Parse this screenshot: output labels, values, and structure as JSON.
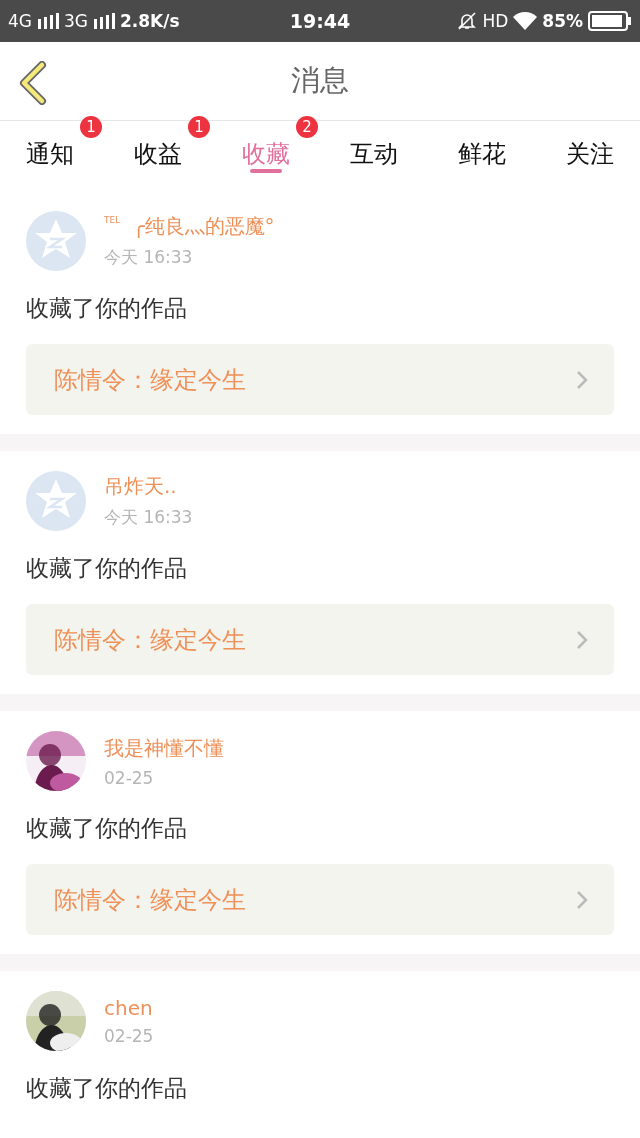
{
  "status_bar": {
    "network_1": "4G",
    "network_2": "3G",
    "speed": "2.8K/s",
    "time": "19:44",
    "hd": "HD",
    "battery": "85%"
  },
  "header": {
    "title": "消息"
  },
  "tabs": [
    {
      "label": "通知",
      "selected": false,
      "badge": "1"
    },
    {
      "label": "收益",
      "selected": false,
      "badge": "1"
    },
    {
      "label": "收藏",
      "selected": true,
      "badge": "2"
    },
    {
      "label": "互动",
      "selected": false
    },
    {
      "label": "鲜花",
      "selected": false
    },
    {
      "label": "关注",
      "selected": false
    }
  ],
  "messages": [
    {
      "avatar": {
        "kind": "default"
      },
      "user": "$^{TEL}$ ╭纯良灬的恶魔°",
      "time": "今天 16:33",
      "action": "收藏了你的作品",
      "work": "陈情令：缘定今生"
    },
    {
      "avatar": {
        "kind": "default"
      },
      "user": "吊炸天..",
      "time": "今天 16:33",
      "action": "收藏了你的作品",
      "work": "陈情令：缘定今生"
    },
    {
      "user": "我是神懂不懂",
      "time": "02-25",
      "action": "收藏了你的作品",
      "work": "陈情令：缘定今生"
    },
    {
      "user": "chen",
      "time": "02-25",
      "action": "收藏了你的作品"
    }
  ]
}
